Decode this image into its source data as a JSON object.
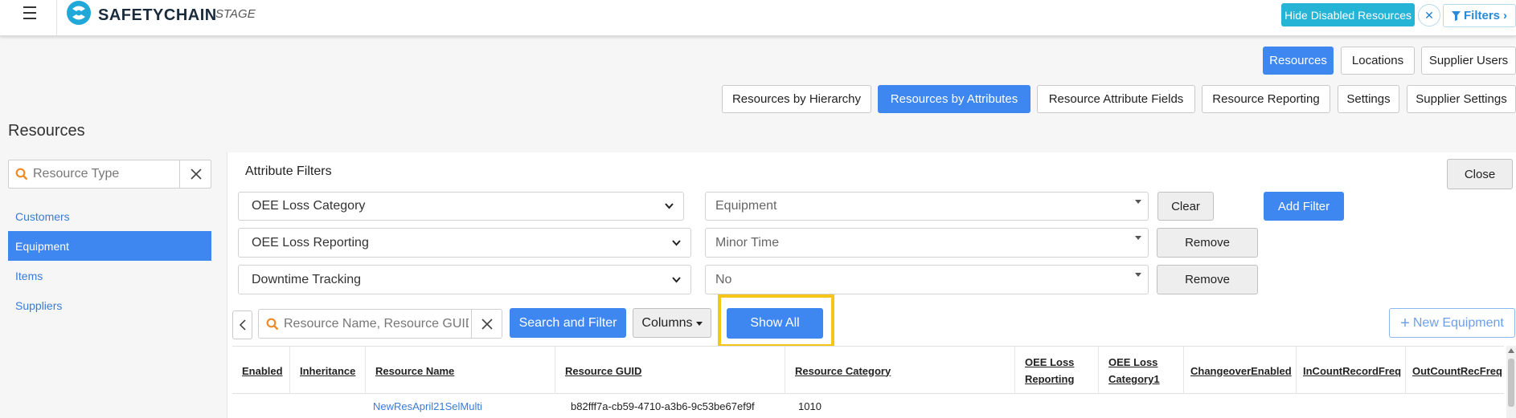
{
  "topbar": {
    "brand": "SAFETYCHAIN",
    "environment": "STAGE",
    "hide_disabled_label": "Hide Disabled Resources",
    "clear_icon": "close-icon",
    "filters_label": "Filters",
    "filters_icon": "funnel-icon"
  },
  "nav_primary": [
    "Resources",
    "Locations",
    "Supplier Users"
  ],
  "nav_secondary": [
    "Resources by Hierarchy",
    "Resources by Attributes",
    "Resource Attribute Fields",
    "Resource Reporting",
    "Settings",
    "Supplier Settings"
  ],
  "page_title": "Resources",
  "sidebar": {
    "search_placeholder": "Resource Type",
    "items": [
      "Customers",
      "Equipment",
      "Items",
      "Suppliers"
    ],
    "active_item": "Equipment"
  },
  "attribute_filters": {
    "title": "Attribute Filters",
    "close_label": "Close",
    "add_filter_label": "Add Filter",
    "rows": [
      {
        "attribute": "OEE Loss Category",
        "value": "Equipment",
        "action": "Clear"
      },
      {
        "attribute": "OEE Loss Reporting",
        "value": "Minor Time",
        "action": "Remove"
      },
      {
        "attribute": "Downtime Tracking",
        "value": "No",
        "action": "Remove"
      }
    ]
  },
  "toolbar": {
    "search_placeholder": "Resource Name, Resource GUID",
    "search_filter_label": "Search and Filter",
    "columns_label": "Columns",
    "show_all_label": "Show All",
    "new_equipment_label": "New Equipment"
  },
  "table": {
    "columns": [
      "Enabled",
      "Inheritance",
      "Resource Name",
      "Resource GUID",
      "Resource Category",
      "OEE Loss Reporting",
      "OEE Loss Category1",
      "ChangeoverEnabled",
      "InCountRecordFreq",
      "OutCountRecFreq"
    ],
    "rows": [
      {
        "enabled": "",
        "inheritance": "",
        "resource_name": "NewResApril21SelMulti",
        "resource_guid": "b82fff7a-cb59-4710-a3b6-9c53be67ef9f",
        "resource_category": "1010"
      }
    ]
  },
  "colors": {
    "primary": "#3e86f0",
    "accent_cyan": "#25b4d6",
    "highlight": "#f5c518",
    "link": "#3a7bd5"
  }
}
